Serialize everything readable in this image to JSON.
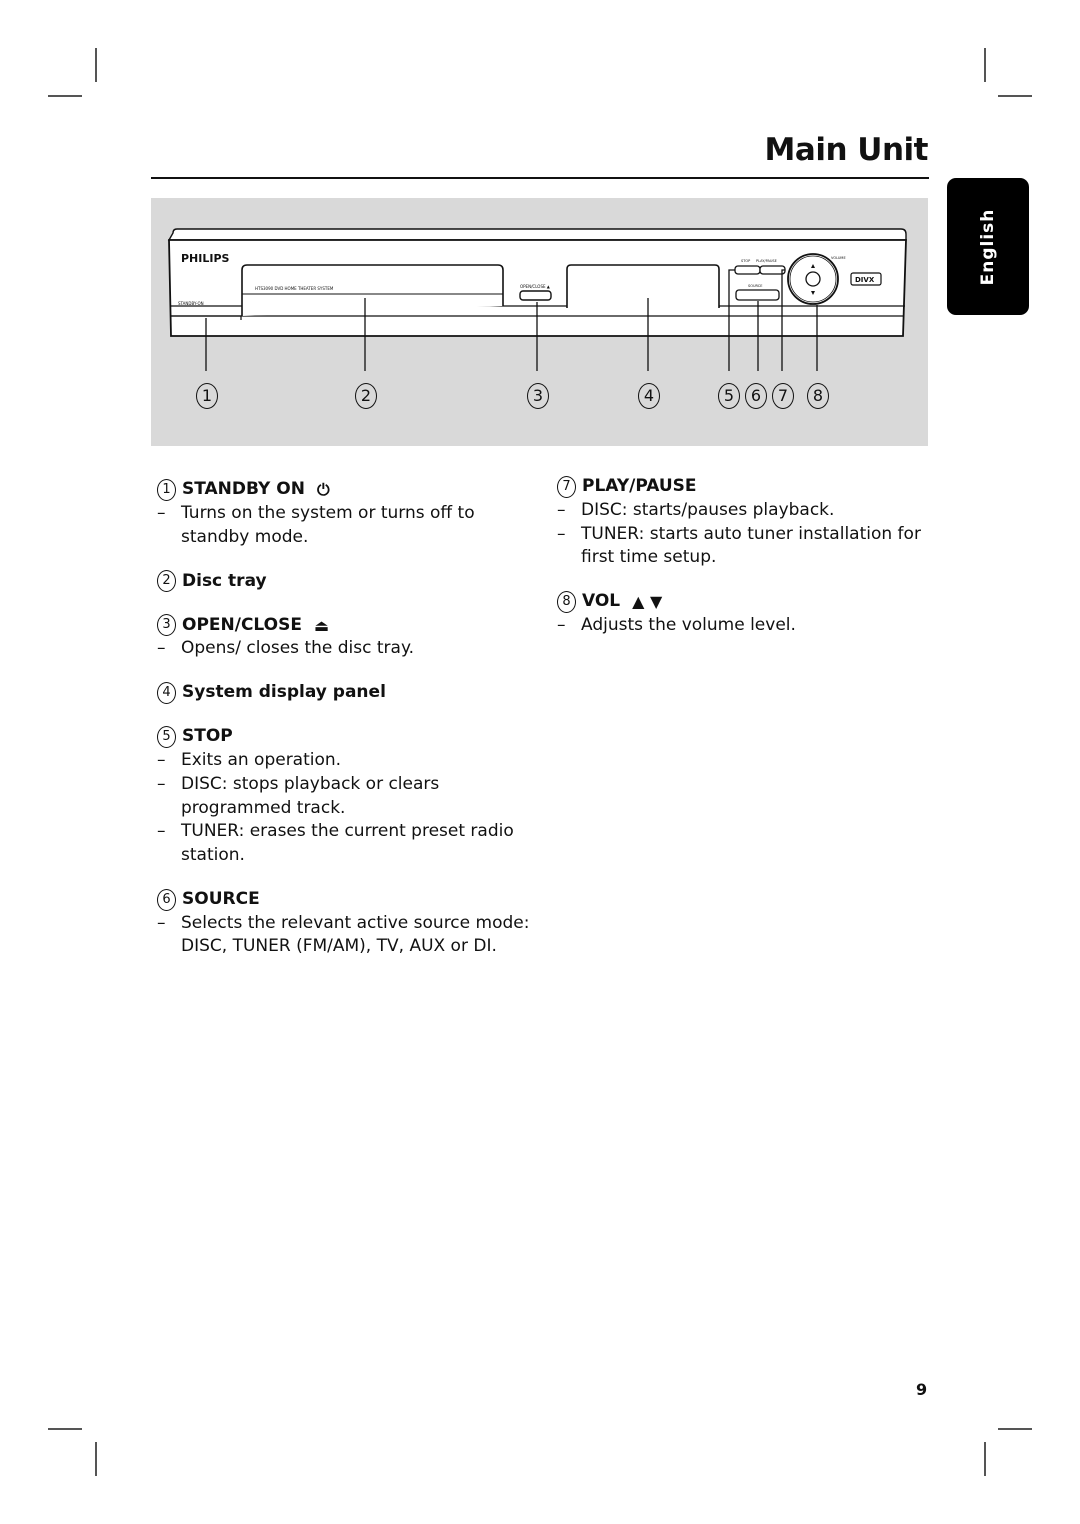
{
  "page": {
    "title": "Main Unit",
    "language_tab": "English",
    "page_number": "9"
  },
  "figure": {
    "brand": "PHILIPS",
    "model_label": "HTS3090 DVD HOME THEATER SYSTEM",
    "standby_label": "STANDBY-ON",
    "open_close_label": "OPEN/CLOSE ▲",
    "stop_label": "STOP",
    "play_pause_label": "PLAY/PAUSE",
    "source_label": "SOURCE",
    "volume_label": "VOLUME",
    "divx_label": "DIVX",
    "callouts": [
      "1",
      "2",
      "3",
      "4",
      "5",
      "6",
      "7",
      "8"
    ]
  },
  "left_column": [
    {
      "num": "1",
      "title": "STANDBY ON",
      "symbol": "⏻",
      "bullets": [
        "Turns on the system or turns off to standby mode."
      ]
    },
    {
      "num": "2",
      "title": "Disc tray",
      "symbol": "",
      "bullets": []
    },
    {
      "num": "3",
      "title": "OPEN/CLOSE",
      "symbol": "⏏",
      "bullets": [
        "Opens/ closes the disc tray."
      ]
    },
    {
      "num": "4",
      "title": "System display panel",
      "symbol": "",
      "bullets": []
    },
    {
      "num": "5",
      "title": "STOP",
      "symbol": "",
      "bullets": [
        "Exits an operation.",
        "DISC: stops playback or clears programmed track.",
        "TUNER: erases the current preset radio station."
      ]
    },
    {
      "num": "6",
      "title": "SOURCE",
      "symbol": "",
      "bullets": [
        "Selects the relevant active source mode: DISC, TUNER (FM/AM), TV, AUX or DI."
      ]
    }
  ],
  "right_column": [
    {
      "num": "7",
      "title": "PLAY/PAUSE",
      "symbol": "",
      "bullets": [
        "DISC: starts/pauses playback.",
        "TUNER: starts auto tuner installation for first time setup."
      ]
    },
    {
      "num": "8",
      "title": "VOL",
      "symbol": "▲ ▼",
      "bullets": [
        "Adjusts the volume level."
      ]
    }
  ]
}
